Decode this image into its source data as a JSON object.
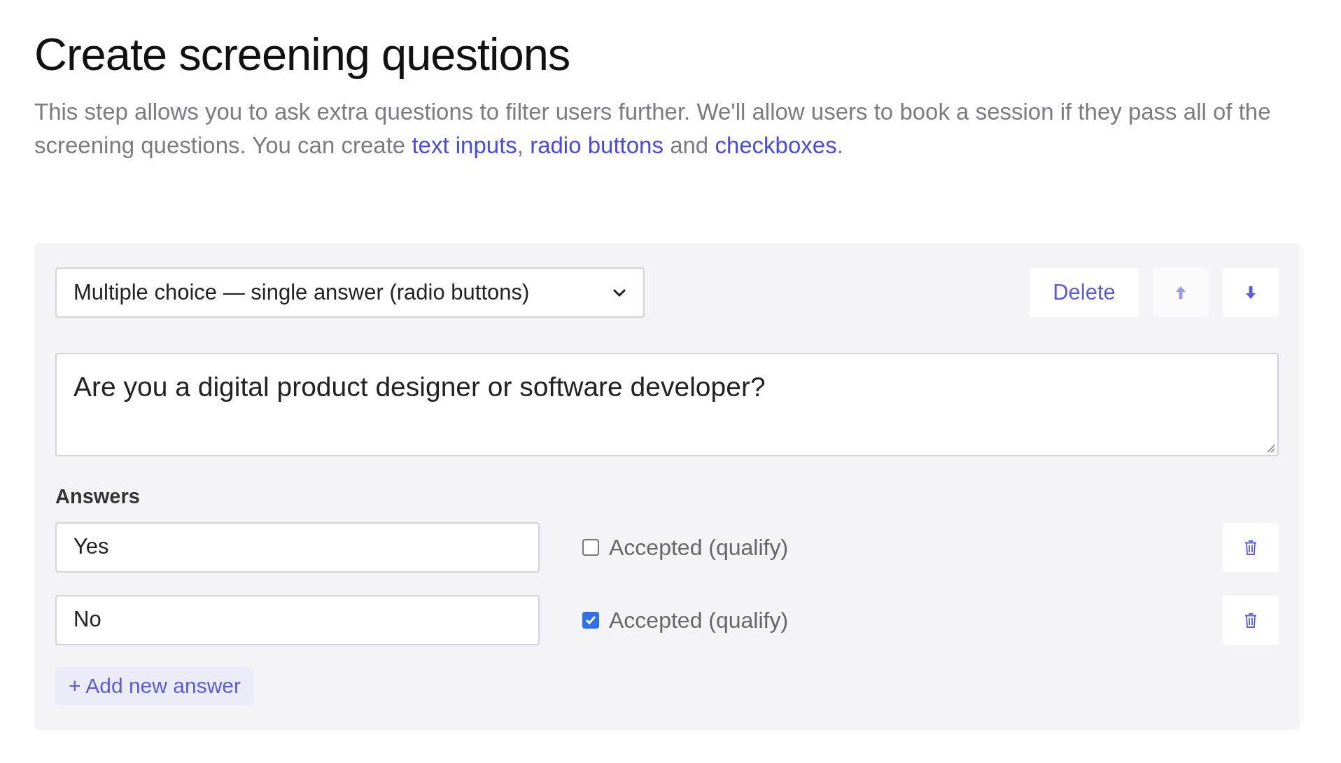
{
  "title": "Create screening questions",
  "description": [
    {
      "kind": "text",
      "text": "This step allows you to ask extra questions to filter users further. We'll allow users to book a session if they pass all of the screening questions. You can create "
    },
    {
      "kind": "link",
      "text": "text inputs"
    },
    {
      "kind": "text",
      "text": ", "
    },
    {
      "kind": "link",
      "text": "radio buttons"
    },
    {
      "kind": "text",
      "text": " and "
    },
    {
      "kind": "link",
      "text": "checkboxes"
    },
    {
      "kind": "text",
      "text": "."
    }
  ],
  "question": {
    "type_select": {
      "value": "Multiple choice — single answer (radio buttons)"
    },
    "delete_button": "Delete",
    "move_up": {
      "disabled": true
    },
    "move_down": {
      "disabled": false
    },
    "text": "Are you a digital product designer or software developer?",
    "answers_label": "Answers",
    "answers": [
      {
        "value": "Yes",
        "accepted_label": "Accepted (qualify)",
        "checked": false
      },
      {
        "value": "No",
        "accepted_label": "Accepted (qualify)",
        "checked": true
      }
    ],
    "add_button": "+ Add new answer"
  }
}
